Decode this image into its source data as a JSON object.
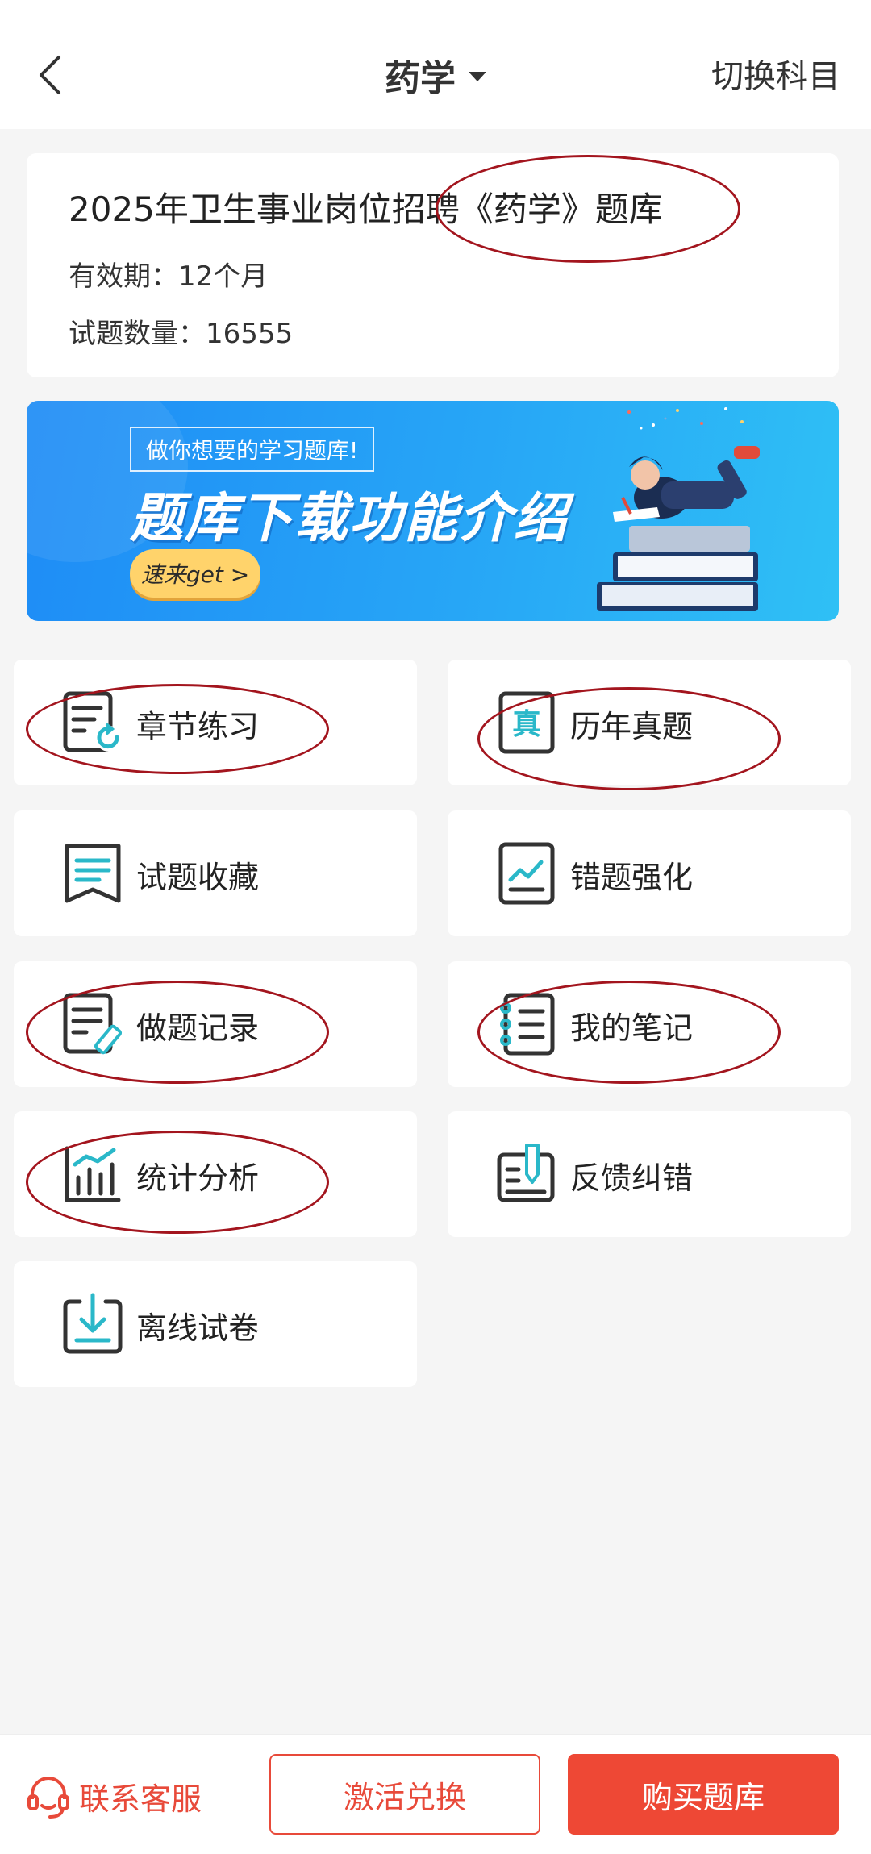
{
  "header": {
    "title": "药学",
    "switch_label": "切换科目"
  },
  "info": {
    "title": "2025年卫生事业岗位招聘《药学》题库",
    "validity": "有效期：12个月",
    "question_count": "试题数量：16555"
  },
  "banner": {
    "tag": "做你想要的学习题库!",
    "headline": "题库下载功能介绍",
    "cta": "速来get >"
  },
  "grid": {
    "chapter_practice": "章节练习",
    "past_papers": "历年真题",
    "past_papers_icon_char": "真",
    "favorites": "试题收藏",
    "wrong_reinforce": "错题强化",
    "practice_record": "做题记录",
    "my_notes": "我的笔记",
    "stats_analysis": "统计分析",
    "feedback": "反馈纠错",
    "offline_papers": "离线试卷"
  },
  "bottom": {
    "service_label": "联系客服",
    "activate_label": "激活兑换",
    "buy_label": "购买题库"
  },
  "colors": {
    "accent": "#ee4835",
    "icon_teal": "#2ab8c9",
    "annotation": "#a3151e"
  }
}
